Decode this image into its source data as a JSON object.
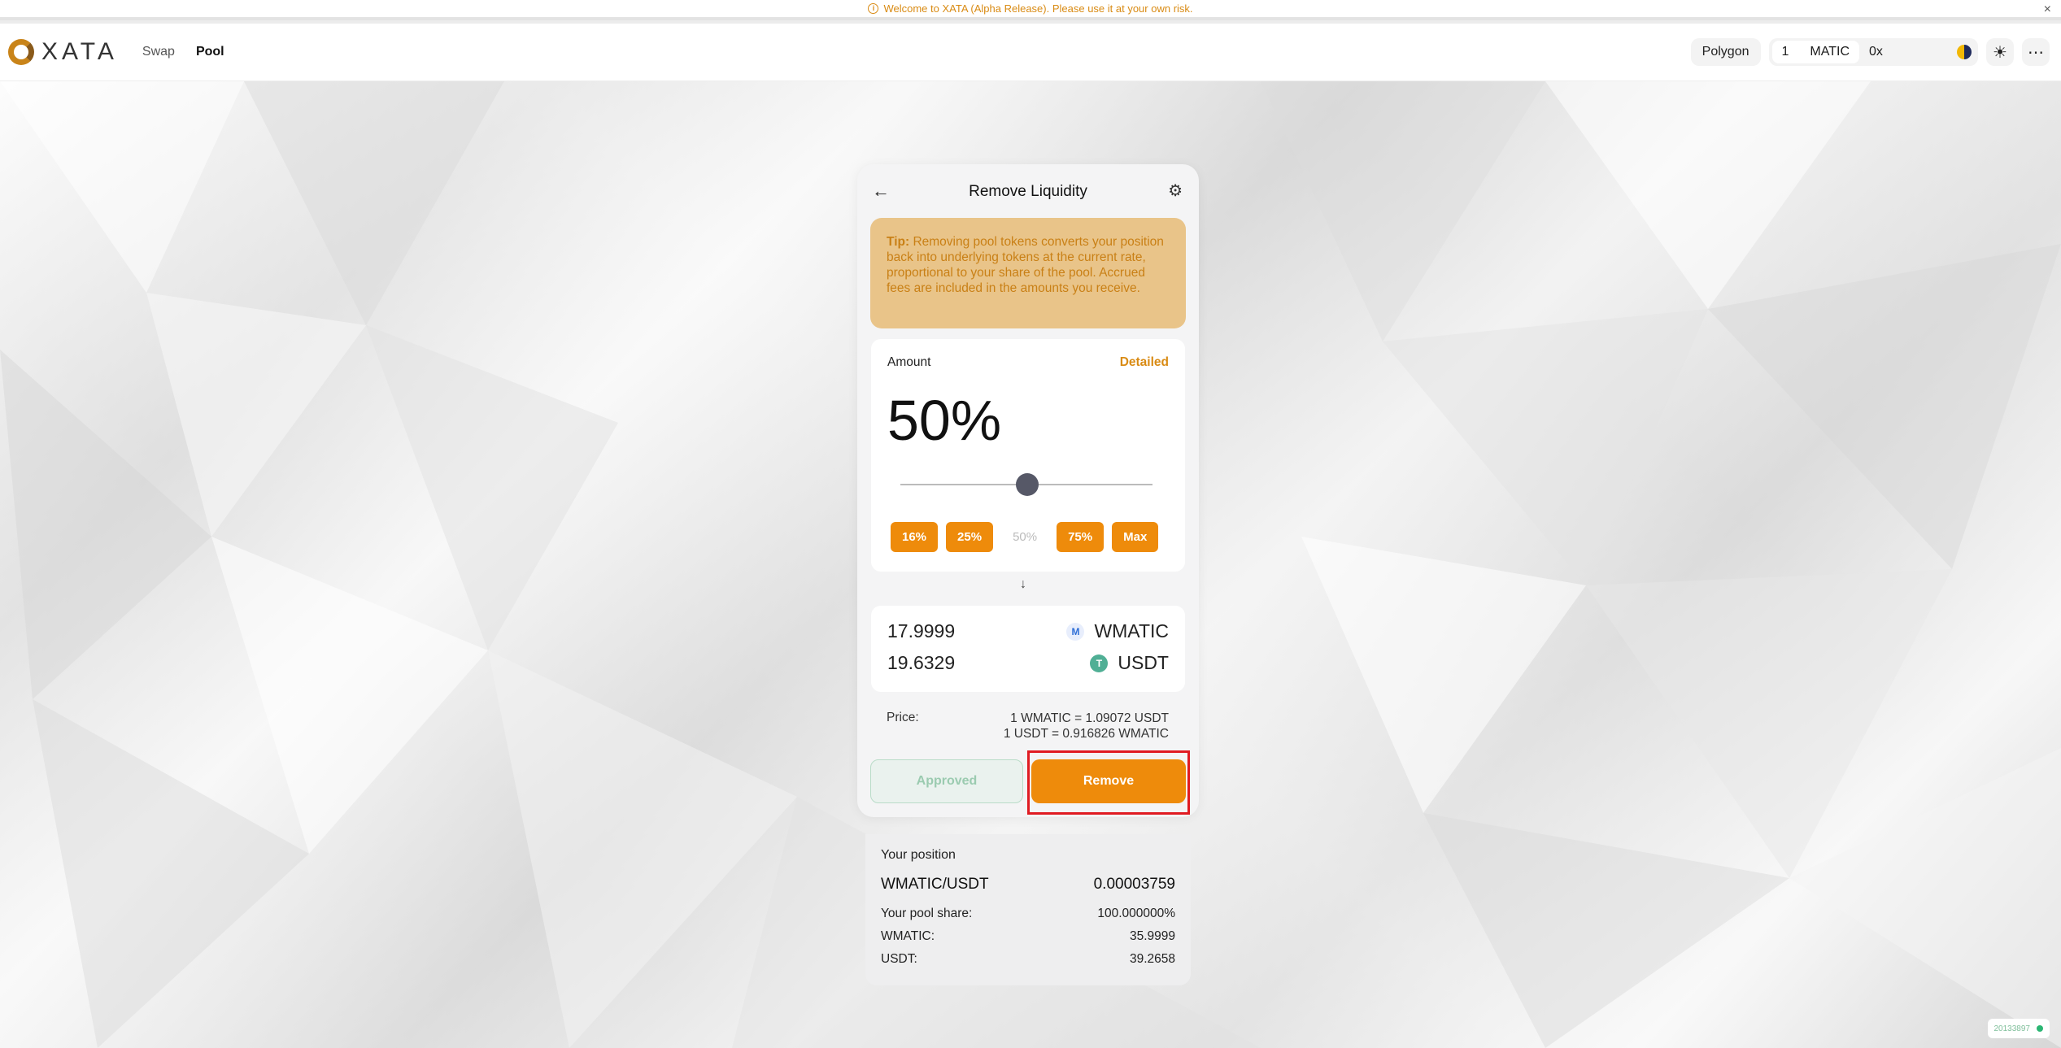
{
  "banner": {
    "message": "Welcome to XATA (Alpha Release). Please use it at your own risk.",
    "close_glyph": "×"
  },
  "header": {
    "logo_text": "XATA",
    "nav": [
      {
        "label": "Swap",
        "active": false
      },
      {
        "label": "Pool",
        "active": true
      }
    ],
    "network": "Polygon",
    "balance_amount": "1",
    "balance_symbol": "MATIC",
    "address": "0x"
  },
  "card": {
    "title": "Remove Liquidity",
    "tip_label": "Tip:",
    "tip_text": "Removing pool tokens converts your position back into underlying tokens at the current rate, proportional to your share of the pool. Accrued fees are included in the amounts you receive.",
    "amount_label": "Amount",
    "detailed_label": "Detailed",
    "amount_percent": "50%",
    "slider_value": 50,
    "preset_buttons": [
      "16%",
      "25%",
      "50%",
      "75%",
      "Max"
    ],
    "selected_preset": "50%",
    "outputs": [
      {
        "amount": "17.9999",
        "symbol": "WMATIC",
        "icon": "wmatic-icon"
      },
      {
        "amount": "19.6329",
        "symbol": "USDT",
        "icon": "usdt-icon"
      }
    ],
    "price_label": "Price:",
    "price_line_1": "1 WMATIC = 1.09072 USDT",
    "price_line_2": "1 USDT = 0.916826 WMATIC",
    "approved_label": "Approved",
    "remove_label": "Remove"
  },
  "position": {
    "title": "Your position",
    "pair": "WMATIC/USDT",
    "lp_amount": "0.00003759",
    "rows": [
      {
        "label": "Your pool share:",
        "value": "100.000000%"
      },
      {
        "label": "WMATIC:",
        "value": "35.9999"
      },
      {
        "label": "USDT:",
        "value": "39.2658"
      }
    ]
  },
  "footer": {
    "block_number": "20133897"
  },
  "colors": {
    "accent": "#ee8b0b",
    "tip_bg": "#e9c489",
    "highlight": "#e01b22"
  }
}
